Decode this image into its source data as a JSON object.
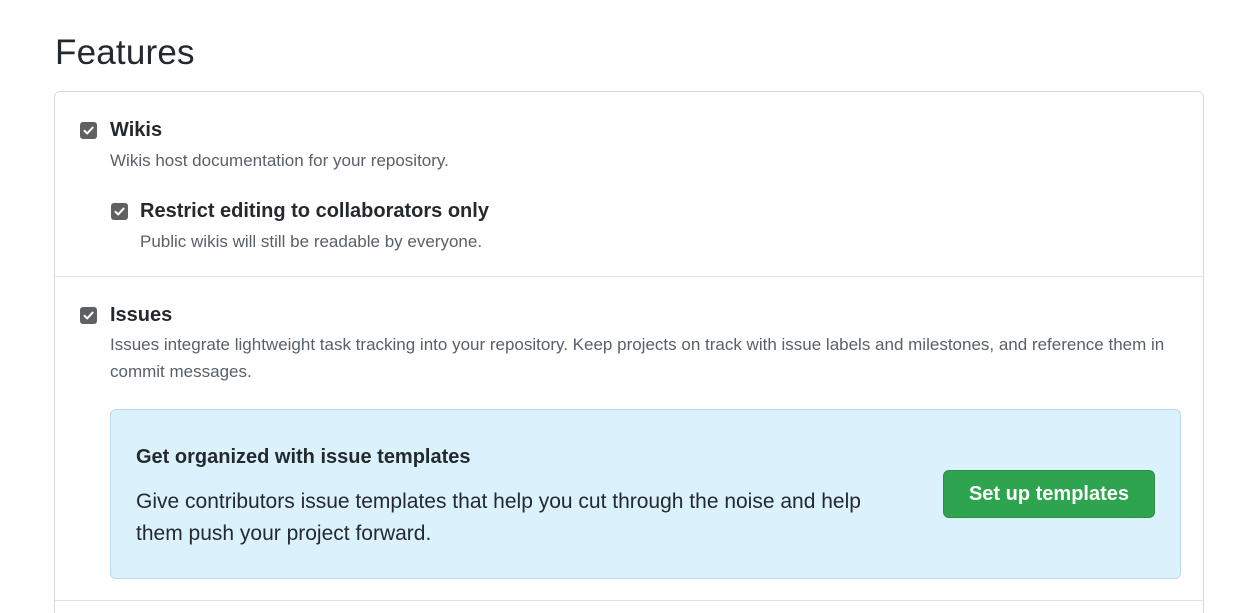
{
  "page_title": "Features",
  "options": {
    "wikis": {
      "label": "Wikis",
      "description": "Wikis host documentation for your repository.",
      "checked": true
    },
    "restrict_editing": {
      "label": "Restrict editing to collaborators only",
      "description": "Public wikis will still be readable by everyone.",
      "checked": true
    },
    "issues": {
      "label": "Issues",
      "description": "Issues integrate lightweight task tracking into your repository. Keep projects on track with issue labels and milestones, and reference them in commit messages.",
      "checked": true
    }
  },
  "issue_templates_promo": {
    "title": "Get organized with issue templates",
    "body": "Give contributors issue templates that help you cut through the noise and help them push your project forward.",
    "button_label": "Set up templates"
  },
  "colors": {
    "button": "#2ea44f",
    "promo_background": "#dbf2fc",
    "checkbox": "#5f6062"
  }
}
